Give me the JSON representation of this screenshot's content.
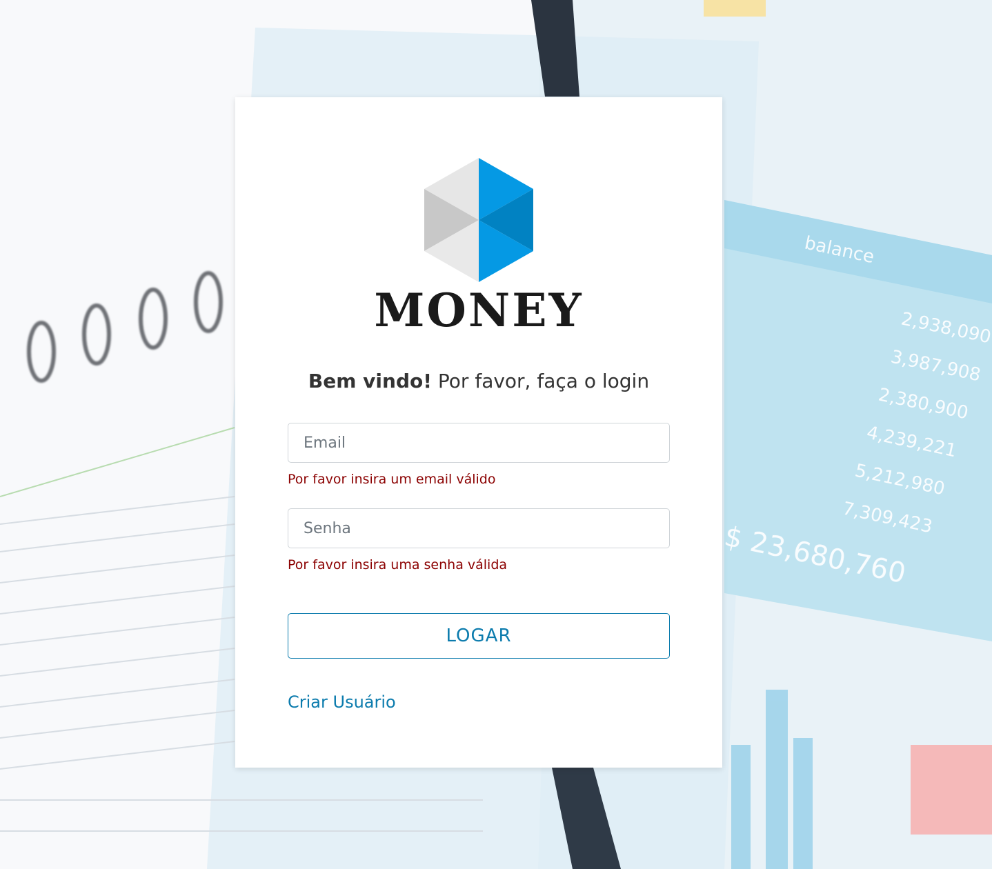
{
  "background": {
    "table_header": "balance",
    "table_values": [
      "2,938,090",
      "3,987,908",
      "2,380,900",
      "4,239,221",
      "5,212,980",
      "7,309,423"
    ],
    "table_total": "$ 23,680,760"
  },
  "brand": {
    "name": "MONEY",
    "colors": {
      "blue_light": "#0599e4",
      "blue_dark": "#0182c2",
      "gray_light": "#e8e8e8",
      "gray_dark": "#c9c9c9"
    }
  },
  "login": {
    "welcome_strong": "Bem vindo!",
    "welcome_rest": " Por favor, faça o login",
    "email": {
      "placeholder": "Email",
      "value": "",
      "error": "Por favor insira um email válido"
    },
    "password": {
      "placeholder": "Senha",
      "value": "",
      "error": "Por favor insira uma senha válida"
    },
    "submit_label": "LOGAR",
    "create_user_label": "Criar Usuário"
  },
  "colors": {
    "accent": "#0b7bad",
    "error": "#8b0000"
  }
}
